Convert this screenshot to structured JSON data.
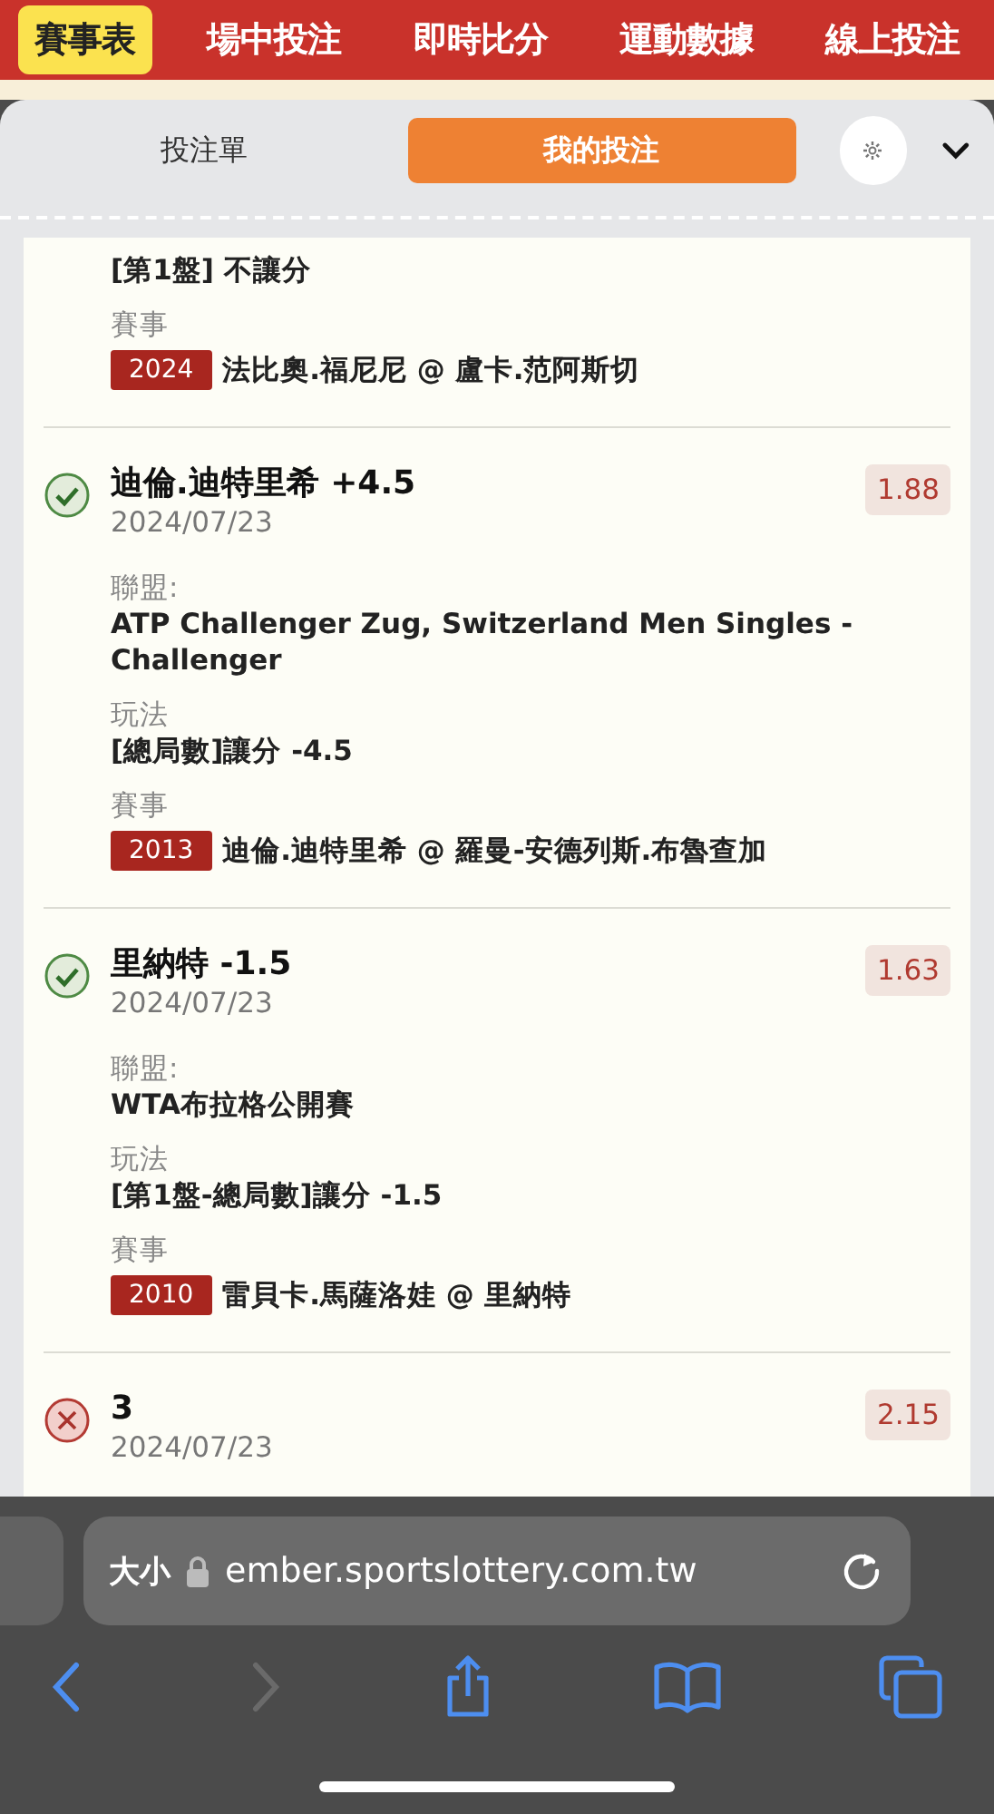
{
  "nav": [
    {
      "label": "賽事表",
      "selected": true
    },
    {
      "label": "場中投注",
      "selected": false
    },
    {
      "label": "即時比分",
      "selected": false
    },
    {
      "label": "運動數據",
      "selected": false
    },
    {
      "label": "線上投注",
      "selected": false
    }
  ],
  "tabs": [
    {
      "label": "投注單",
      "selected": false
    },
    {
      "label": "我的投注",
      "selected": true
    }
  ],
  "bets": [
    {
      "fields": [
        {
          "value": "[第1盤] 不讓分"
        }
      ],
      "event": {
        "label": "賽事",
        "code": "2024",
        "match": "法比奧.福尼尼 @ 盧卡.范阿斯切"
      }
    },
    {
      "won": true,
      "name": "迪倫.迪特里希 +4.5",
      "date": "2024/07/23",
      "odds": "1.88",
      "fields": [
        {
          "label": "聯盟:",
          "value": "ATP Challenger Zug, Switzerland Men Singles - Challenger"
        },
        {
          "label": "玩法",
          "value": "[總局數]讓分 -4.5"
        }
      ],
      "event": {
        "label": "賽事",
        "code": "2013",
        "match": "迪倫.迪特里希 @ 羅曼-安德列斯.布魯查加"
      }
    },
    {
      "won": true,
      "name": "里納特 -1.5",
      "date": "2024/07/23",
      "odds": "1.63",
      "fields": [
        {
          "label": "聯盟:",
          "value": "WTA布拉格公開賽"
        },
        {
          "label": "玩法",
          "value": "[第1盤-總局數]讓分 -1.5"
        }
      ],
      "event": {
        "label": "賽事",
        "code": "2010",
        "match": "雷貝卡.馬薩洛娃 @ 里納特"
      }
    },
    {
      "won": false,
      "name": "3",
      "date": "2024/07/23",
      "odds": "2.15"
    }
  ],
  "browser": {
    "text_size": "大小",
    "url": "ember.sportslottery.com.tw"
  }
}
